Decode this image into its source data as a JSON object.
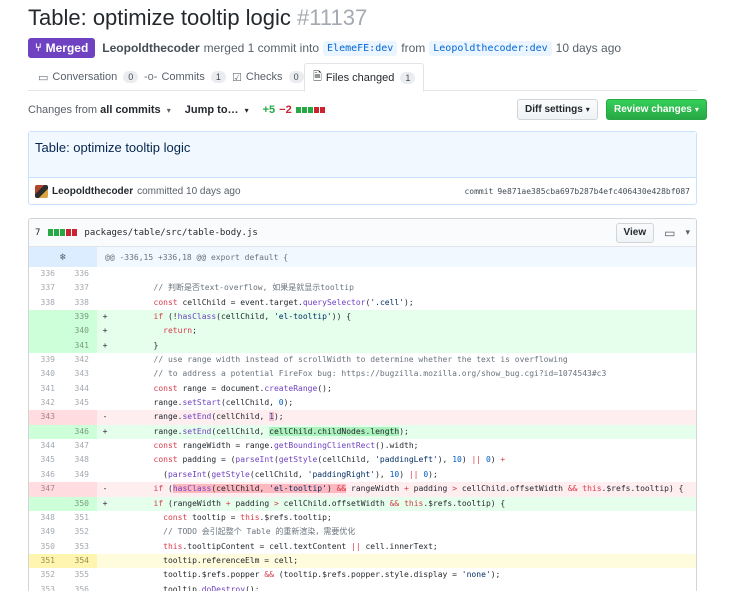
{
  "header": {
    "title": "Table: optimize tooltip logic",
    "number": "#11137",
    "state": "Merged",
    "author": "Leopoldthecoder",
    "summary": "merged 1 commit into",
    "base_branch": "ElemeFE:dev",
    "from_text": "from",
    "head_branch": "Leopoldthecoder:dev",
    "when": "10 days ago"
  },
  "tabs": [
    {
      "label": "Conversation",
      "count": "0",
      "icon": "comment-icon"
    },
    {
      "label": "Commits",
      "count": "1",
      "icon": "commit-icon"
    },
    {
      "label": "Checks",
      "count": "0",
      "icon": "checks-icon"
    },
    {
      "label": "Files changed",
      "count": "1",
      "icon": "file-diff-icon"
    }
  ],
  "toolbar": {
    "changes_from_prefix": "Changes from",
    "changes_from_value": "all commits",
    "jump_to": "Jump to…",
    "additions": "+5",
    "deletions": "−2",
    "diffstat": [
      "add",
      "add",
      "add",
      "del",
      "del"
    ],
    "diff_settings": "Diff settings",
    "review_changes": "Review changes"
  },
  "commit": {
    "title": "Table: optimize tooltip logic",
    "author": "Leopoldthecoder",
    "action": "committed",
    "when": "10 days ago",
    "sha_label": "commit",
    "sha": "9e871ae385cba697b287b4efc406430e428bf087"
  },
  "file": {
    "changes": "7",
    "diffstat": [
      "add",
      "add",
      "add",
      "del",
      "del"
    ],
    "path": "packages/table/src/table-body.js",
    "view_label": "View",
    "hunk": "@@ -336,15 +336,18 @@ export default {"
  },
  "colors": {
    "merged": "#6f42c1",
    "add": "#28a745",
    "del": "#cb2431",
    "add_bg": "#e6ffed",
    "del_bg": "#ffeef0",
    "highlight_bg": "#fffbdd"
  },
  "lines": [
    {
      "type": "ctx",
      "old": "336",
      "new": "336",
      "marker": "",
      "code": ""
    },
    {
      "type": "ctx",
      "old": "337",
      "new": "337",
      "marker": "",
      "code": "        // 判断是否text-overflow, 如果是就显示tooltip"
    },
    {
      "type": "ctx",
      "old": "338",
      "new": "338",
      "marker": "",
      "code": "        const cellChild = event.target.querySelector('.cell');"
    },
    {
      "type": "add",
      "old": "",
      "new": "339",
      "marker": "+",
      "code": "        if (!hasClass(cellChild, 'el-tooltip')) {"
    },
    {
      "type": "add",
      "old": "",
      "new": "340",
      "marker": "+",
      "code": "          return;"
    },
    {
      "type": "add",
      "old": "",
      "new": "341",
      "marker": "+",
      "code": "        }"
    },
    {
      "type": "ctx",
      "old": "339",
      "new": "342",
      "marker": "",
      "code": "        // use range width instead of scrollWidth to determine whether the text is overflowing"
    },
    {
      "type": "ctx",
      "old": "340",
      "new": "343",
      "marker": "",
      "code": "        // to address a potential FireFox bug: https://bugzilla.mozilla.org/show_bug.cgi?id=1074543#c3"
    },
    {
      "type": "ctx",
      "old": "341",
      "new": "344",
      "marker": "",
      "code": "        const range = document.createRange();"
    },
    {
      "type": "ctx",
      "old": "342",
      "new": "345",
      "marker": "",
      "code": "        range.setStart(cellChild, 0);"
    },
    {
      "type": "del",
      "old": "343",
      "new": "",
      "marker": "-",
      "code": "        range.setEnd(cellChild, 1);"
    },
    {
      "type": "add",
      "old": "",
      "new": "346",
      "marker": "+",
      "code": "        range.setEnd(cellChild, cellChild.childNodes.length);"
    },
    {
      "type": "ctx",
      "old": "344",
      "new": "347",
      "marker": "",
      "code": "        const rangeWidth = range.getBoundingClientRect().width;"
    },
    {
      "type": "ctx",
      "old": "345",
      "new": "348",
      "marker": "",
      "code": "        const padding = (parseInt(getStyle(cellChild, 'paddingLeft'), 10) || 0) +"
    },
    {
      "type": "ctx",
      "old": "346",
      "new": "349",
      "marker": "",
      "code": "          (parseInt(getStyle(cellChild, 'paddingRight'), 10) || 0);"
    },
    {
      "type": "del",
      "old": "347",
      "new": "",
      "marker": "-",
      "code": "        if (hasClass(cellChild, 'el-tooltip') && rangeWidth + padding > cellChild.offsetWidth && this.$refs.tooltip) {"
    },
    {
      "type": "add",
      "old": "",
      "new": "350",
      "marker": "+",
      "code": "        if (rangeWidth + padding > cellChild.offsetWidth && this.$refs.tooltip) {"
    },
    {
      "type": "ctx",
      "old": "348",
      "new": "351",
      "marker": "",
      "code": "          const tooltip = this.$refs.tooltip;"
    },
    {
      "type": "ctx",
      "old": "349",
      "new": "352",
      "marker": "",
      "code": "          // TODO 会引起整个 Table 的重新渲染，需要优化"
    },
    {
      "type": "ctx",
      "old": "350",
      "new": "353",
      "marker": "",
      "code": "          this.tooltipContent = cell.textContent || cell.innerText;"
    },
    {
      "type": "hl",
      "old": "351",
      "new": "354",
      "marker": "",
      "code": "          tooltip.referenceElm = cell;"
    },
    {
      "type": "ctx",
      "old": "352",
      "new": "355",
      "marker": "",
      "code": "          tooltip.$refs.popper && (tooltip.$refs.popper.style.display = 'none');"
    },
    {
      "type": "ctx",
      "old": "353",
      "new": "356",
      "marker": "",
      "code": "          tooltip.doDestroy();"
    }
  ]
}
